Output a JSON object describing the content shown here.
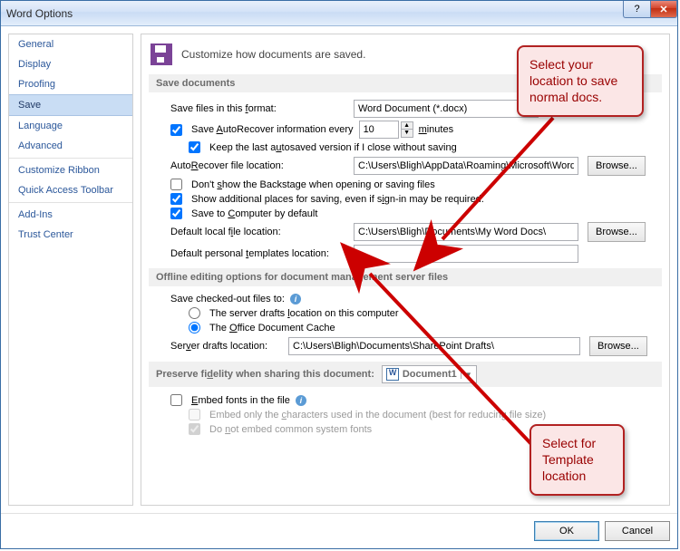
{
  "window": {
    "title": "Word Options"
  },
  "sidebar": {
    "items": [
      "General",
      "Display",
      "Proofing",
      "Save",
      "Language",
      "Advanced",
      "Customize Ribbon",
      "Quick Access Toolbar",
      "Add-Ins",
      "Trust Center"
    ],
    "selected": "Save"
  },
  "header": "Customize how documents are saved.",
  "sections": {
    "save_documents": "Save documents",
    "offline": "Offline editing options for document management server files",
    "preserve": "Preserve fidelity when sharing this document:"
  },
  "fields": {
    "save_format_label": "Save files in this format:",
    "save_format_value": "Word Document (*.docx)",
    "autorecover_label_pre": "Save AutoRecover information every",
    "autorecover_value": "10",
    "autorecover_label_post": "minutes",
    "keep_last": "Keep the last autosaved version if I close without saving",
    "autorecover_loc_label": "AutoRecover file location:",
    "autorecover_loc_value": "C:\\Users\\Bligh\\AppData\\Roaming\\Microsoft\\Word\\",
    "dont_show_backstage": "Don't show the Backstage when opening or saving files",
    "show_additional": "Show additional places for saving, even if sign-in may be required.",
    "save_to_computer": "Save to Computer by default",
    "default_local_label": "Default local file location:",
    "default_local_value": "C:\\Users\\Bligh\\Documents\\My Word Docs\\",
    "default_templates_label": "Default personal templates location:",
    "default_templates_value": "",
    "checked_out_label": "Save checked-out files to:",
    "radio_server_drafts": "The server drafts location on this computer",
    "radio_office_cache": "The Office Document Cache",
    "server_drafts_label": "Server drafts location:",
    "server_drafts_value": "C:\\Users\\Bligh\\Documents\\SharePoint Drafts\\",
    "preserve_doc": "Document1",
    "embed_fonts": "Embed fonts in the file",
    "embed_chars": "Embed only the characters used in the document (best for reducing file size)",
    "no_common_fonts": "Do not embed common system fonts"
  },
  "buttons": {
    "browse": "Browse...",
    "ok": "OK",
    "cancel": "Cancel"
  },
  "callouts": {
    "top": "Select your location to save normal docs.",
    "bottom": "Select for Template location"
  }
}
